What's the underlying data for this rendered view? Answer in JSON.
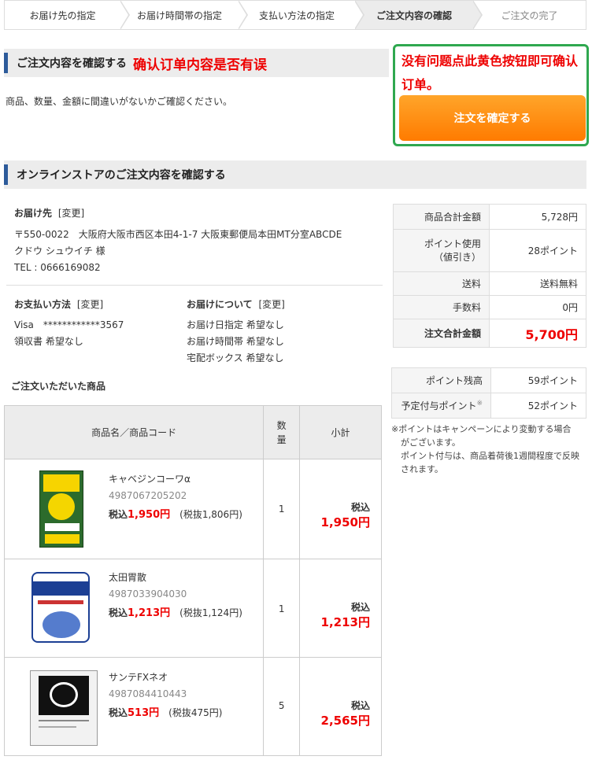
{
  "steps": [
    {
      "label": "お届け先の指定",
      "state": "normal"
    },
    {
      "label": "お届け時間帯の指定",
      "state": "normal"
    },
    {
      "label": "支払い方法の指定",
      "state": "normal"
    },
    {
      "label": "ご注文内容の確認",
      "state": "active"
    },
    {
      "label": "ご注文の完了",
      "state": "done"
    }
  ],
  "confirm_section": {
    "title": "ご注文内容を確認する",
    "note_cn": "确认订单内容是否有误",
    "description": "商品、数量、金額に間違いがないかご確認ください。",
    "annotation": "没有问题点此黄色按钮即可确认订单。",
    "confirm_button": "注文を確定する"
  },
  "store_section": {
    "title": "オンラインストアのご注文内容を確認する"
  },
  "delivery": {
    "heading": "お届け先",
    "change": "[変更]",
    "address": "〒550-0022　大阪府大阪市西区本田4-1-7 大阪東郵便局本田MT分室ABCDE",
    "name": "クドウ シュウイチ 様",
    "tel": "TEL : 0666169082"
  },
  "payment": {
    "heading": "お支払い方法",
    "change": "[変更]",
    "card": "Visa　************3567",
    "receipt": "領収書 希望なし"
  },
  "shipping": {
    "heading": "お届けについて",
    "change": "[変更]",
    "lines": [
      "お届け日指定 希望なし",
      "お届け時間帯 希望なし",
      "宅配ボックス 希望なし"
    ]
  },
  "summary": [
    {
      "label": "商品合計金額",
      "value": "5,728円"
    },
    {
      "label": "ポイント使用\n（値引き）",
      "value": "28ポイント"
    },
    {
      "label": "送料",
      "value": "送料無料"
    },
    {
      "label": "手数料",
      "value": "0円"
    },
    {
      "label": "注文合計金額",
      "value": "5,700円"
    }
  ],
  "points": [
    {
      "label": "ポイント残高",
      "value": "59ポイント"
    },
    {
      "label": "予定付与ポイント",
      "mark": "※",
      "value": "52ポイント"
    }
  ],
  "points_note": [
    "※ポイントはキャンペーンにより変動する場合",
    "がございます。",
    "ポイント付与は、商品着荷後1週間程度で反映",
    "されます。"
  ],
  "products_heading": "ご注文いただいた商品",
  "product_table": {
    "col_name": "商品名／商品コード",
    "col_qty": "数\n量",
    "col_sub": "小計"
  },
  "products": [
    {
      "name": "キャベジンコーワα",
      "code": "4987067205202",
      "price_label": "税込",
      "price": "1,950円",
      "tax_ex": "(税抜1,806円)",
      "qty": "1",
      "sub_label": "税込",
      "subtotal": "1,950円",
      "image": "cabbagin-box-image"
    },
    {
      "name": "太田胃散",
      "code": "4987033904030",
      "price_label": "税込",
      "price": "1,213円",
      "tax_ex": "(税抜1,124円)",
      "qty": "1",
      "sub_label": "税込",
      "subtotal": "1,213円",
      "image": "ota-isan-can-image"
    },
    {
      "name": "サンテFXネオ",
      "code": "4987084410443",
      "price_label": "税込",
      "price": "513円",
      "tax_ex": "(税抜475円)",
      "qty": "5",
      "sub_label": "税込",
      "subtotal": "2,565円",
      "image": "sante-fx-box-image"
    }
  ],
  "colors": {
    "accent_red": "#e00000",
    "button_orange": "#ff8a00",
    "green_border": "#2fa84f",
    "header_blue": "#2d5b9a"
  }
}
